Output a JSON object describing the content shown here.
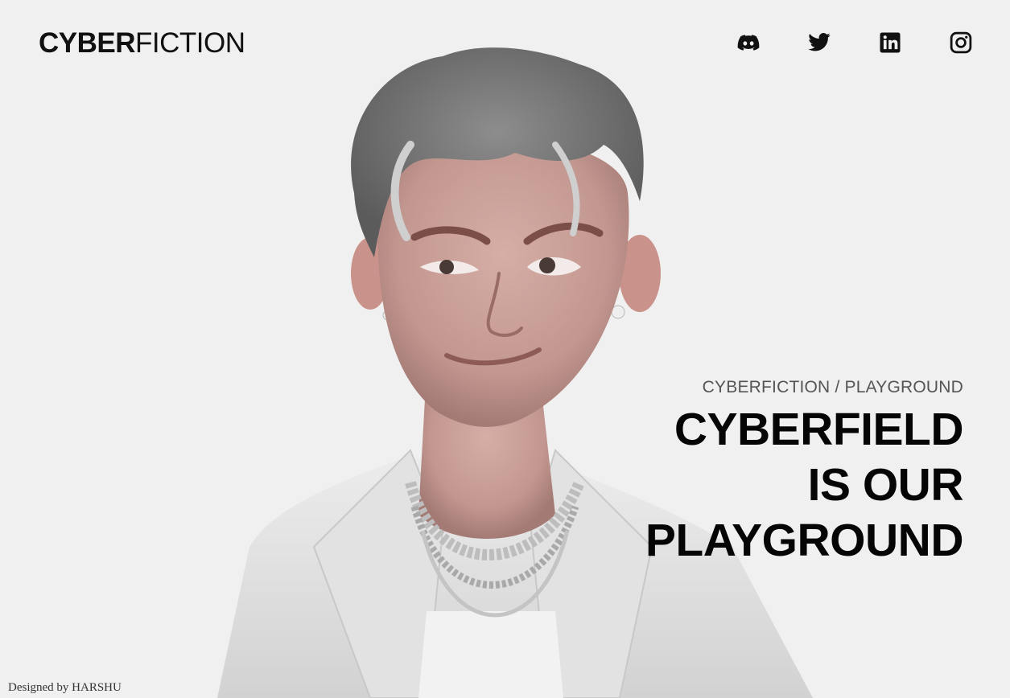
{
  "header": {
    "logo_bold": "CYBER",
    "logo_light": "FICTION",
    "social": [
      {
        "name": "discord-icon"
      },
      {
        "name": "twitter-icon"
      },
      {
        "name": "linkedin-icon"
      },
      {
        "name": "instagram-icon"
      }
    ]
  },
  "hero": {
    "kicker": "CYBERFICTION / PLAYGROUND",
    "headline_lines": [
      "CYBERFIELD",
      "IS OUR",
      "PLAYGROUND"
    ]
  },
  "footer": {
    "credit": "Designed by HARSHU"
  },
  "colors": {
    "background": "#f1f0f0",
    "text": "#050505",
    "muted": "#555555"
  }
}
